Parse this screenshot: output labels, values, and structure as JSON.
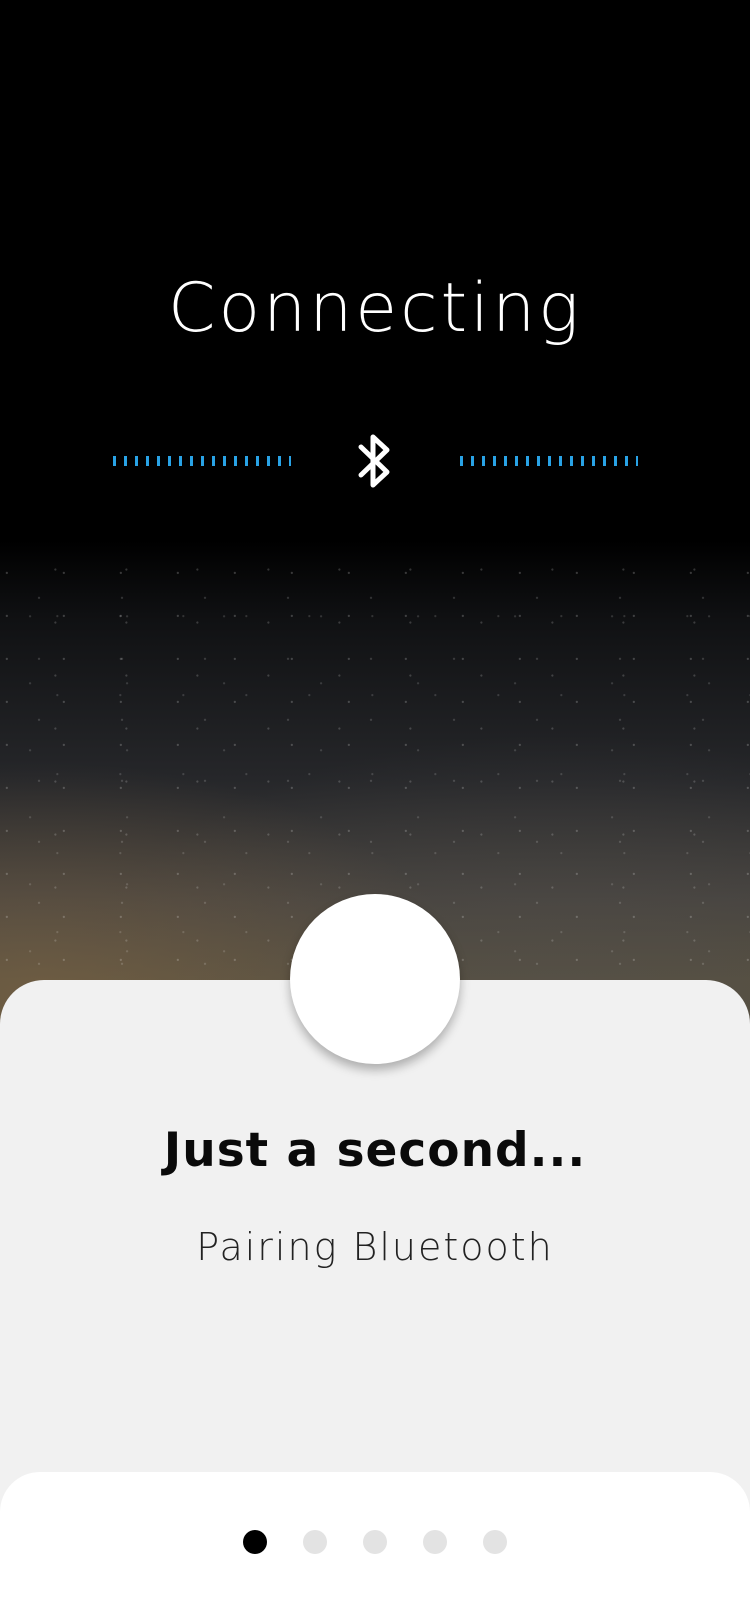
{
  "header": {
    "title": "Connecting"
  },
  "connection": {
    "icon": "bluetooth-icon",
    "dash_color": "#29a3e6"
  },
  "card": {
    "heading": "Just a second...",
    "subheading": "Pairing Bluetooth"
  },
  "pagination": {
    "total": 5,
    "active_index": 0,
    "active_color": "#000000",
    "inactive_color": "#e3e3e3"
  }
}
